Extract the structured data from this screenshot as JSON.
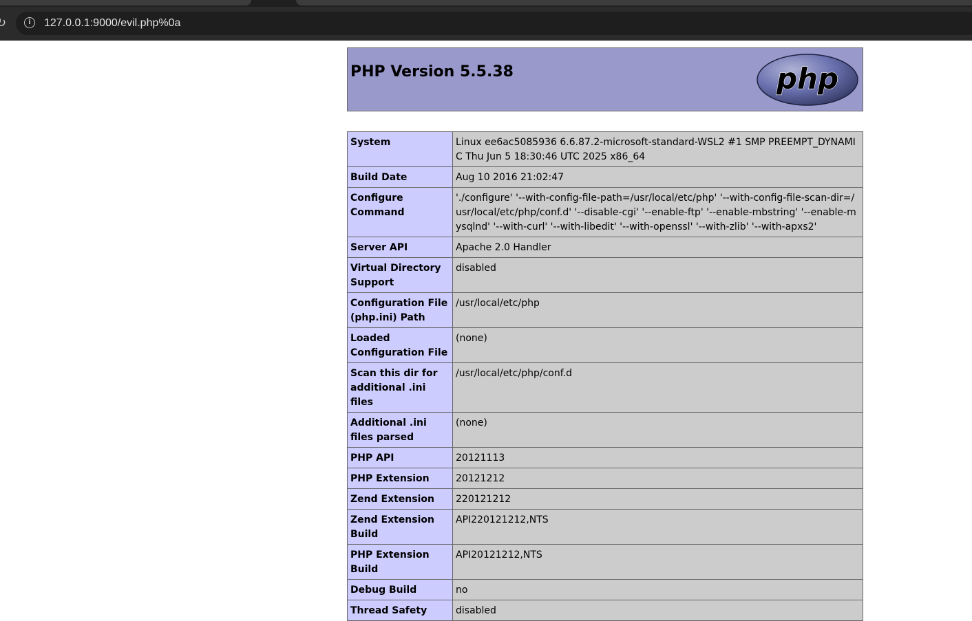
{
  "browser": {
    "url": "127.0.0.1:9000/evil.php%0a",
    "reload_glyph": "↻",
    "info_glyph": "i"
  },
  "page": {
    "title": "PHP Version 5.5.38",
    "logo_text": "php"
  },
  "rows": [
    {
      "key": "System",
      "value": "Linux ee6ac5085936 6.6.87.2-microsoft-standard-WSL2 #1 SMP PREEMPT_DYNAMIC Thu Jun 5 18:30:46 UTC 2025 x86_64"
    },
    {
      "key": "Build Date",
      "value": "Aug 10 2016 21:02:47"
    },
    {
      "key": "Configure Command",
      "value": "'./configure' '--with-config-file-path=/usr/local/etc/php' '--with-config-file-scan-dir=/usr/local/etc/php/conf.d' '--disable-cgi' '--enable-ftp' '--enable-mbstring' '--enable-mysqlnd' '--with-curl' '--with-libedit' '--with-openssl' '--with-zlib' '--with-apxs2'"
    },
    {
      "key": "Server API",
      "value": "Apache 2.0 Handler"
    },
    {
      "key": "Virtual Directory Support",
      "value": "disabled"
    },
    {
      "key": "Configuration File (php.ini) Path",
      "value": "/usr/local/etc/php"
    },
    {
      "key": "Loaded Configuration File",
      "value": "(none)"
    },
    {
      "key": "Scan this dir for additional .ini files",
      "value": "/usr/local/etc/php/conf.d"
    },
    {
      "key": "Additional .ini files parsed",
      "value": "(none)"
    },
    {
      "key": "PHP API",
      "value": "20121113"
    },
    {
      "key": "PHP Extension",
      "value": "20121212"
    },
    {
      "key": "Zend Extension",
      "value": "220121212"
    },
    {
      "key": "Zend Extension Build",
      "value": "API220121212,NTS"
    },
    {
      "key": "PHP Extension Build",
      "value": "API20121212,NTS"
    },
    {
      "key": "Debug Build",
      "value": "no"
    },
    {
      "key": "Thread Safety",
      "value": "disabled"
    }
  ],
  "colors": {
    "header_bg": "#9999cc",
    "key_bg": "#ccccff",
    "value_bg": "#cccccc",
    "border": "#666666"
  }
}
